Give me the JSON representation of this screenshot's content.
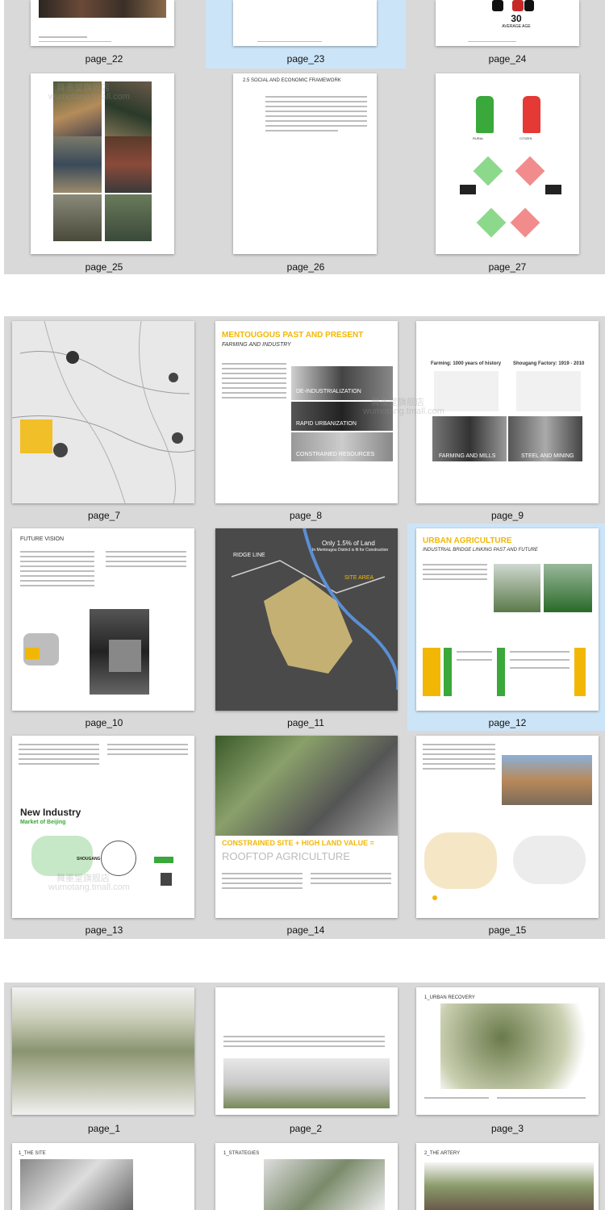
{
  "groups": [
    {
      "pages": [
        {
          "label": "page_22"
        },
        {
          "label": "page_23"
        },
        {
          "label": "page_24"
        },
        {
          "label": "page_25"
        },
        {
          "label": "page_26"
        },
        {
          "label": "page_27"
        }
      ],
      "page_24_text": {
        "age": "30",
        "age_label": "AVERAGE AGE"
      },
      "page_26_text": {
        "heading": "2.5 SOCIAL AND ECONOMIC FRAMEWORK"
      },
      "page_27_text": {
        "left_fig": "RURAL",
        "right_fig": "CITIZEN"
      }
    },
    {
      "pages": [
        {
          "label": "page_7"
        },
        {
          "label": "page_8"
        },
        {
          "label": "page_9"
        },
        {
          "label": "page_10"
        },
        {
          "label": "page_11"
        },
        {
          "label": "page_12"
        },
        {
          "label": "page_13"
        },
        {
          "label": "page_14"
        },
        {
          "label": "page_15"
        }
      ],
      "page_8_text": {
        "title": "MENTOUGOUS PAST AND PRESENT",
        "subtitle": "FARMING AND INDUSTRY",
        "captions": [
          "DE-INDUSTRIALIZATION",
          "RAPID URBANIZATION",
          "CONSTRAINED RESOURCES"
        ]
      },
      "page_9_text": {
        "left_title": "Farming: 1000 years of history",
        "right_title": "Shougang Factory: 1919 - 2010",
        "left_caption": "FARMING AND MILLS",
        "right_caption": "STEEL AND MINING"
      },
      "page_10_text": {
        "title": "FUTURE VISION"
      },
      "page_11_text": {
        "ridge": "RIDGE LINE",
        "stat": "Only 1.5% of Land",
        "stat_sub": "In Mentougou District is fit for Construction",
        "site": "SITE AREA"
      },
      "page_12_text": {
        "title": "URBAN AGRICULTURE",
        "subtitle": "INDUSTRIAL BRIDGE LINKING PAST AND FUTURE"
      },
      "page_13_text": {
        "title": "New Industry",
        "subtitle": "Market of Beijing",
        "location": "SHOUGANG"
      },
      "page_14_text": {
        "title": "CONSTRAINED SITE + HIGH LAND VALUE =",
        "subtitle": "ROOFTOP AGRICULTURE"
      }
    },
    {
      "pages": [
        {
          "label": "page_1"
        },
        {
          "label": "page_2"
        },
        {
          "label": "page_3"
        },
        {
          "label": ""
        },
        {
          "label": ""
        },
        {
          "label": ""
        }
      ],
      "page_3_text": {
        "heading": "1_URBAN RECOVERY"
      },
      "bottom_text": {
        "left": "1_THE SITE",
        "middle": "1_STRATEGIES",
        "right": "2_THE ARTERY"
      }
    }
  ],
  "watermark": {
    "cn": "舞墨堂旗舰店",
    "en": "wumotang.tmall.com"
  },
  "colors": {
    "group_bg": "#d9d9d9",
    "selected_bg": "#cce4f7",
    "accent_yellow": "#f2b705",
    "green": "#3aa83a",
    "red": "#e53935"
  }
}
